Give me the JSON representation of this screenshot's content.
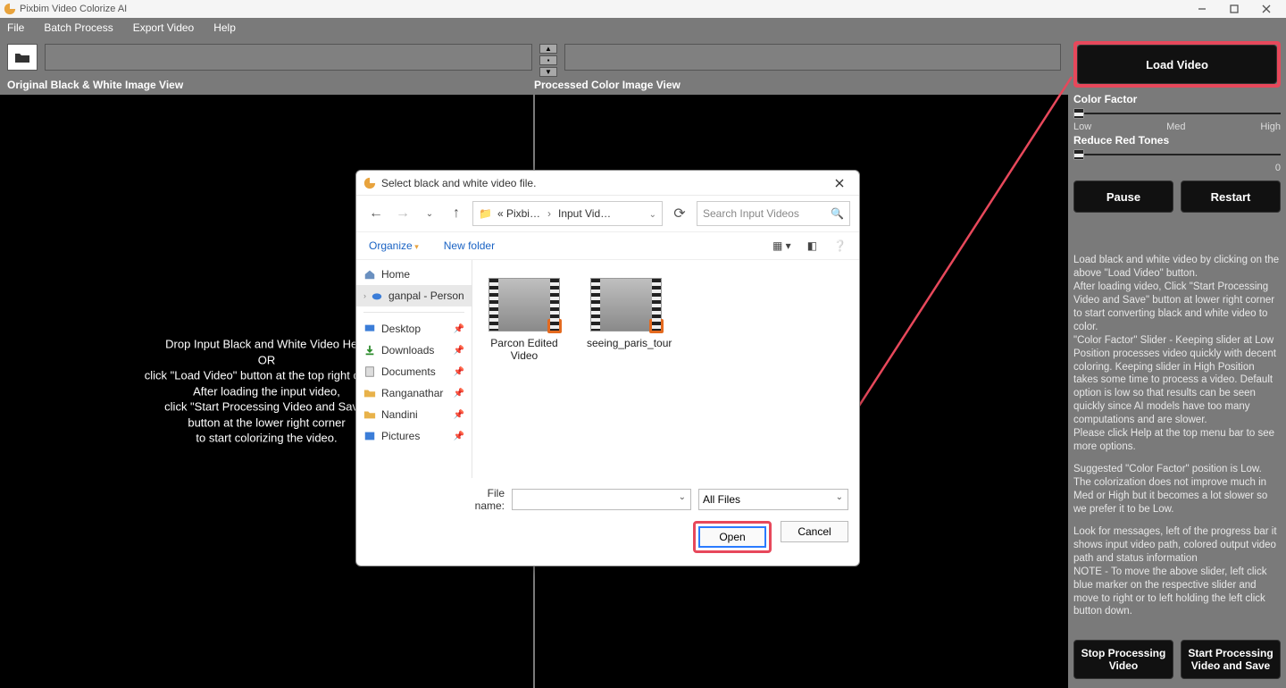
{
  "title": "Pixbim Video Colorize AI",
  "menu": {
    "file": "File",
    "batch": "Batch Process",
    "export": "Export Video",
    "help": "Help"
  },
  "viewLabels": {
    "left": "Original Black & White Image View",
    "right": "Processed Color Image View"
  },
  "dropMessage": {
    "l1": "Drop Input Black and White Video Here",
    "l2": "OR",
    "l3": "click \"Load Video\" button at the top right corner.",
    "gap": " ",
    "l4": "After loading the input video,",
    "l5": "click \"Start Processing Video and Save\"",
    "l6": "button at the lower right corner",
    "l7": "to start colorizing the video."
  },
  "right": {
    "loadVideo": "Load Video",
    "colorFactor": "Color Factor",
    "cfLabels": {
      "low": "Low",
      "med": "Med",
      "high": "High"
    },
    "reduceRed": "Reduce Red Tones",
    "redMax": "0",
    "pause": "Pause",
    "restart": "Restart",
    "info": {
      "p1": "Load black and white video by clicking on the above \"Load Video\" button.",
      "p2": "After loading video, Click \"Start Processing Video and Save\" button at lower right corner to start converting black and white video to color.",
      "p3": "\"Color Factor\" Slider - Keeping slider at Low Position processes video quickly with decent coloring. Keeping slider in High Position takes some time to process a video. Default option is low so that results can be seen quickly since AI models have too many computations and are slower.",
      "p4": "Please click Help at the top menu bar to see more options.",
      "p5": "Suggested \"Color Factor\" position is Low. The colorization does not improve much in Med or High but it becomes a lot slower so we prefer it to be Low.",
      "p6": "Look for messages, left of the progress bar it shows input video path, colored output video path and status information",
      "p7": "NOTE - To move the above slider, left click blue marker on the respective slider and move to right or to left holding the left click button down."
    },
    "stop": "Stop Processing Video",
    "start": "Start Processing Video and Save"
  },
  "dialog": {
    "title": "Select black and white video file.",
    "crumb1": "« Pixbi…",
    "crumb2": "Input Vid…",
    "searchPlaceholder": "Search Input Videos",
    "organize": "Organize",
    "newFolder": "New folder",
    "side": {
      "home": "Home",
      "personal": "ganpal - Person",
      "desktop": "Desktop",
      "downloads": "Downloads",
      "documents": "Documents",
      "ranganathar": "Ranganathar",
      "nandini": "Nandini",
      "pictures": "Pictures"
    },
    "files": {
      "f1": "Parcon Edited Video",
      "f2": "seeing_paris_tour"
    },
    "fileNameLabel": "File name:",
    "fileType": "All Files",
    "open": "Open",
    "cancel": "Cancel"
  }
}
